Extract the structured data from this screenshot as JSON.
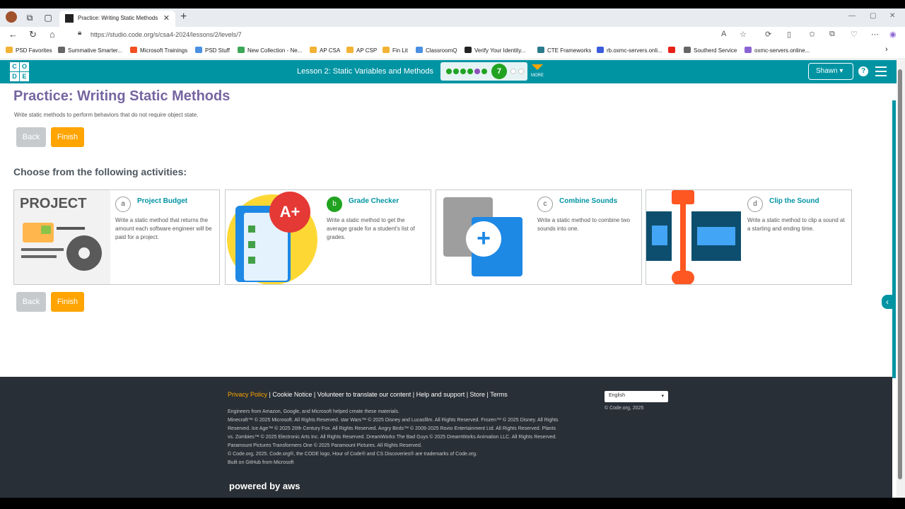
{
  "browser": {
    "tab_title": "Practice: Writing Static Methods",
    "url": "https://studio.code.org/s/csa4-2024/lessons/2/levels/7"
  },
  "bookmarks": [
    {
      "label": "PSD Favorites",
      "color": "#f2b233"
    },
    {
      "label": "Summative Smarter...",
      "color": "#666666"
    },
    {
      "label": "Microsoft Trainings",
      "color": "#f25022"
    },
    {
      "label": "PSD Stuff",
      "color": "#4a90e2"
    },
    {
      "label": "New Collection - Ne...",
      "color": "#3aa757"
    },
    {
      "label": "AP CSA",
      "color": "#f2b233"
    },
    {
      "label": "AP CSP",
      "color": "#f2b233"
    },
    {
      "label": "Fin Lit",
      "color": "#f2b233"
    },
    {
      "label": "ClassroomQ",
      "color": "#4a90e2"
    },
    {
      "label": "Verify Your Identity...",
      "color": "#222222"
    },
    {
      "label": "CTE Frameworks",
      "color": "#2a7a8c"
    },
    {
      "label": "rb.oxmc-servers.onli...",
      "color": "#3b5bdb"
    },
    {
      "label": "",
      "color": "#e62117"
    },
    {
      "label": "Southerd Service",
      "color": "#666666"
    },
    {
      "label": "oxmc-servers.online...",
      "color": "#8a63d2"
    }
  ],
  "header": {
    "logo_letters": [
      "C",
      "O",
      "D",
      "E"
    ],
    "lesson": "Lesson 2: Static Variables and Methods",
    "current_level": "7",
    "more_label": "MORE",
    "user": "Shawn",
    "help": "?"
  },
  "main": {
    "title": "Practice: Writing Static Methods",
    "description": "Write static methods to perform behaviors that do not require object state.",
    "back_label": "Back",
    "finish_label": "Finish",
    "choose_label": "Choose from the following activities:",
    "activities": [
      {
        "letter": "a",
        "title": "Project Budget",
        "desc": "Write a static method that returns the amount each software engineer will be paid for a project.",
        "art_text": "PROJECT",
        "completed": false
      },
      {
        "letter": "b",
        "title": "Grade Checker",
        "desc": "Write a static method to get the average grade for a student's list of grades.",
        "art_text": "A+",
        "completed": true
      },
      {
        "letter": "c",
        "title": "Combine Sounds",
        "desc": "Write a static method to combine two sounds into one.",
        "art_text": "",
        "completed": false
      },
      {
        "letter": "d",
        "title": "Clip the Sound",
        "desc": "Write a static method to clip a sound at a starting and ending time.",
        "art_text": "",
        "completed": false
      }
    ]
  },
  "footer": {
    "privacy": "Privacy Policy",
    "links": " | Cookie Notice | Volunteer to translate our content | Help and support | Store | Terms",
    "lines": [
      "Engineers from Amazon, Google, and Microsoft helped create these materials.",
      "Minecraft™ © 2025 Microsoft. All Rights Reserved. star Wars™ © 2025 Disney and Lucasfilm. All Rights Reserved. Frozen™ © 2025 Disney. All Rights Reserved. Ice Age™ © 2025 20th Century Fox. All Rights Reserved. Angry Birds™ © 2009-2025 Rovio Entertainment Ltd. All Rights Reserved. Plants vs. Zombies™ © 2025 Electronic Arts Inc. All Rights Reserved. DreamWorks The Bad Guys © 2025 DreamWorks Animation LLC. All Rights Reserved. Paramount Pictures Transformers One © 2025 Paramount Pictures. All Rights Reserved.",
      "© Code.org, 2025. Code.org®, the CODE logo, Hour of Code® and CS Discoveries® are trademarks of Code.org.",
      "Built on GitHub from Microsoft"
    ],
    "language": "English",
    "copyright": "© Code.org, 2025",
    "powered": "powered by aws"
  },
  "colors": {
    "teal": "#0094a3",
    "purple": "#7665a0",
    "orange": "#ffa400",
    "green": "#21a321",
    "footer_bg": "#292f36"
  }
}
